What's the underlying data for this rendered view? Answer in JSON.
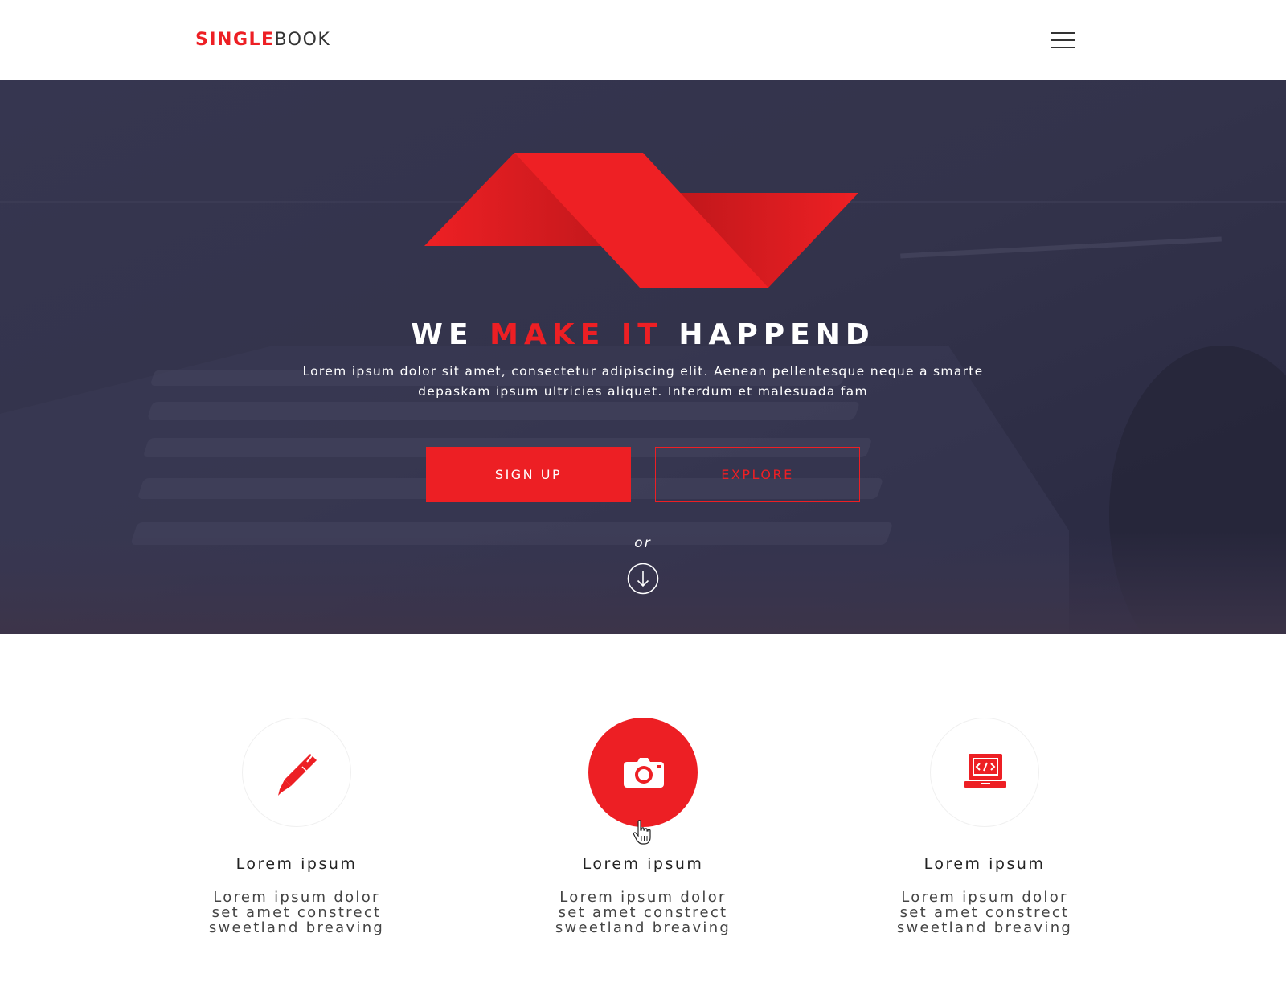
{
  "brand": {
    "logo_part1": "SINGLE",
    "logo_part2": "BOOK",
    "accent_color": "#ed1f24"
  },
  "header": {
    "menu_icon": "hamburger-menu-icon"
  },
  "hero": {
    "title_part1": "WE",
    "title_accent": "MAKE IT",
    "title_part2": "HAPPEND",
    "subtitle": "Lorem ipsum dolor sit amet, consectetur adipiscing elit. Aenean pellentesque neque a smarte depaskam ipsum ultricies aliquet. Interdum et malesuada fam",
    "signup_label": "SIGN UP",
    "explore_label": "EXPLORE",
    "or_text": "or",
    "scroll_icon": "arrow-down-circle-icon",
    "overlay_color": "#2e2e45"
  },
  "features": [
    {
      "icon": "pen-icon",
      "title": "Lorem ipsum",
      "desc_lines": [
        "Lorem ipsum dolor",
        "set amet constrect",
        "sweetland breaving"
      ],
      "active": false
    },
    {
      "icon": "camera-icon",
      "title": "Lorem ipsum",
      "desc_lines": [
        "Lorem ipsum dolor",
        "set amet constrect",
        "sweetland breaving"
      ],
      "active": true
    },
    {
      "icon": "laptop-code-icon",
      "title": "Lorem ipsum",
      "desc_lines": [
        "Lorem ipsum dolor",
        "set amet constrect",
        "sweetland breaving"
      ],
      "active": false
    }
  ]
}
